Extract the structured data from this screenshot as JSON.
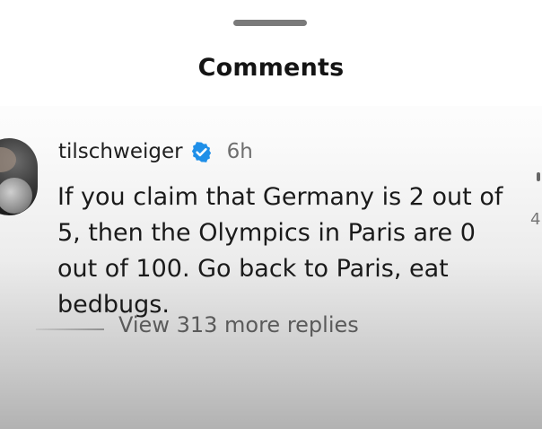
{
  "sheet": {
    "title": "Comments"
  },
  "comment": {
    "username": "tilschweiger",
    "verified": true,
    "time": "6h",
    "text": "If you claim that Germany is 2 out of 5, then the Olympics in Paris are 0 out of 100. Go back to Paris, eat bedbugs.",
    "view_replies": "View 313 more replies"
  },
  "side": {
    "like_count_partial": "4"
  },
  "colors": {
    "verified_badge": "#1f8fe8",
    "background_top": "#ffffff",
    "background_bottom": "#b2b2b2"
  },
  "icons": {
    "verified": "verified-badge-icon"
  }
}
